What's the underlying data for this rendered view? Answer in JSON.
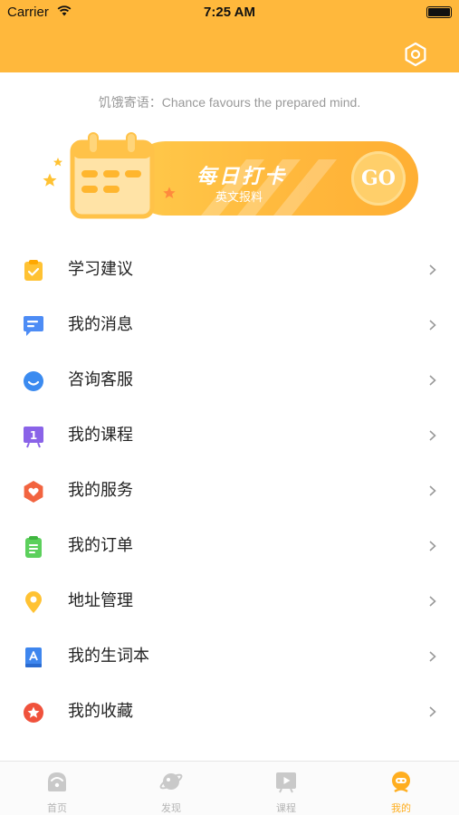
{
  "status_bar": {
    "carrier": "Carrier",
    "time": "7:25 AM"
  },
  "header": {
    "settings_icon": "settings-icon",
    "background_color": "#FFB83C"
  },
  "motto": "饥饿寄语：Chance favours the prepared mind.",
  "banner": {
    "title": "每日打卡",
    "subtitle": "英文报料",
    "go": "GO"
  },
  "menu": {
    "items": [
      {
        "label": "学习建议",
        "icon": "clipboard-icon",
        "color": "#FFC233"
      },
      {
        "label": "我的消息",
        "icon": "message-icon",
        "color": "#4D8CF5"
      },
      {
        "label": "咨询客服",
        "icon": "customer-service-icon",
        "color": "#3B8BF0"
      },
      {
        "label": "我的课程",
        "icon": "course-board-icon",
        "color": "#8A63E8"
      },
      {
        "label": "我的服务",
        "icon": "service-heart-icon",
        "color": "#F26440"
      },
      {
        "label": "我的订单",
        "icon": "order-list-icon",
        "color": "#5CD05C"
      },
      {
        "label": "地址管理",
        "icon": "location-pin-icon",
        "color": "#FFC233"
      },
      {
        "label": "我的生词本",
        "icon": "vocabulary-book-icon",
        "color": "#3E86EE"
      },
      {
        "label": "我的收藏",
        "icon": "favorite-star-icon",
        "color": "#F0523C"
      }
    ]
  },
  "tabbar": {
    "active_color": "#FFAE1F",
    "tabs": [
      {
        "label": "首页",
        "icon": "home-icon"
      },
      {
        "label": "发现",
        "icon": "discover-planet-icon"
      },
      {
        "label": "课程",
        "icon": "course-play-icon"
      },
      {
        "label": "我的",
        "icon": "profile-icon"
      }
    ]
  }
}
